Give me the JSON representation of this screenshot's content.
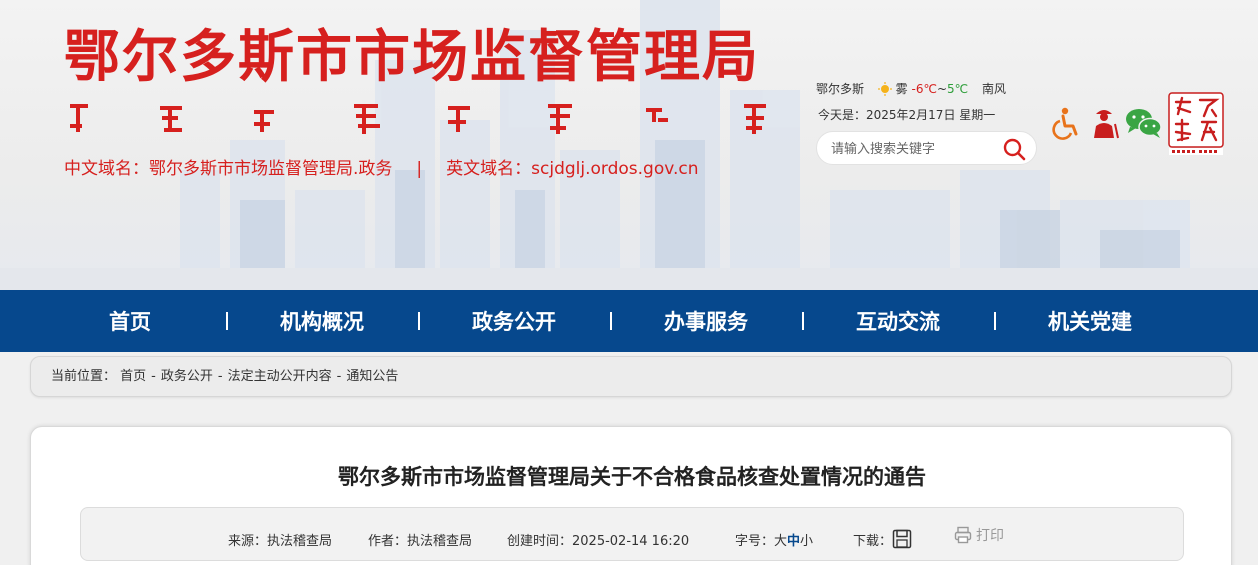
{
  "header": {
    "site_title": "鄂尔多斯市市场监督管理局",
    "cn_domain": "中文域名：鄂尔多斯市市场监督管理局.政务",
    "separator": "|",
    "en_domain": "英文域名：scjdglj.ordos.gov.cn",
    "weather": {
      "city": "鄂尔多斯",
      "condition": "雾",
      "low": "-6℃",
      "range_sep": "~",
      "high": "5℃",
      "wind": "南风"
    },
    "date_line": "今天是：2025年2月17日 星期一",
    "search": {
      "placeholder": "请输入搜索关键字"
    },
    "icons": [
      "accessibility-icon",
      "elderly-mode-icon",
      "wechat-icon"
    ],
    "colors": {
      "brand_red": "#d6201e",
      "nav_blue": "#06488d"
    }
  },
  "nav": {
    "items": [
      {
        "label": "首页"
      },
      {
        "label": "机构概况"
      },
      {
        "label": "政务公开"
      },
      {
        "label": "办事服务"
      },
      {
        "label": "互动交流"
      },
      {
        "label": "机关党建"
      }
    ]
  },
  "breadcrumb": {
    "prefix": "当前位置：",
    "items": [
      "首页",
      "政务公开",
      "法定主动公开内容",
      "通知公告"
    ],
    "separator": "-"
  },
  "article": {
    "title": "鄂尔多斯市市场监督管理局关于不合格食品核查处置情况的通告",
    "meta": {
      "source": "来源：执法稽查局",
      "author": "作者：执法稽查局",
      "created": "创建时间：2025-02-14 16:20",
      "font_size_label": "字号：",
      "size_large": "大",
      "size_medium": "中",
      "size_small": "小",
      "download_label": "下载：",
      "print_label": "打印"
    }
  }
}
